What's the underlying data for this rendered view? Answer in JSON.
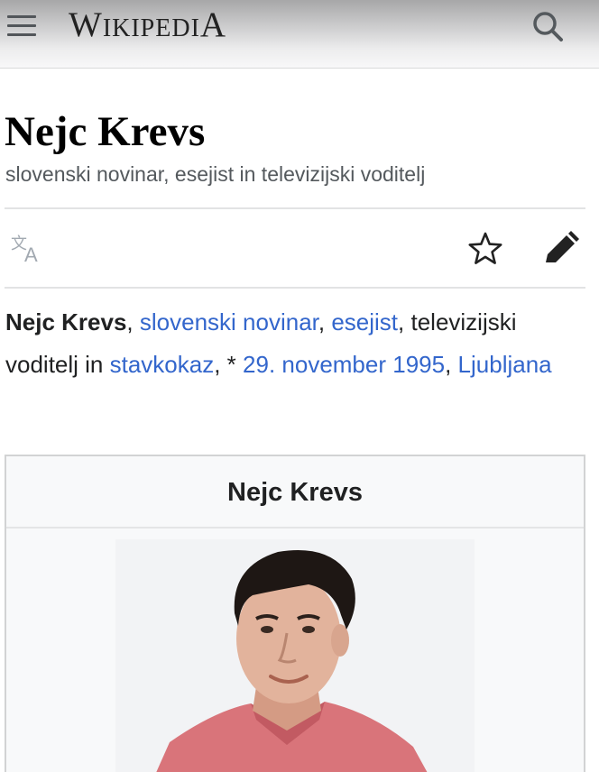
{
  "header": {
    "wordmark": "Wikipedia",
    "menu_icon": "hamburger-menu-icon",
    "search_icon": "search-icon"
  },
  "article": {
    "title": "Nejc Krevs",
    "subtitle": "slovenski novinar, esejist in televizijski voditelj"
  },
  "actions": {
    "language_icon": "language-icon",
    "watch_icon": "star-icon",
    "edit_icon": "pencil-icon"
  },
  "lead": {
    "name": "Nejc Krevs",
    "sep1": ", ",
    "link_journalist": "slovenski novinar",
    "sep2": ", ",
    "link_essayist": "esejist",
    "text_middle": ", televizijski voditelj in ",
    "link_highlighted": "stavkokaz",
    "text_birth": ", * ",
    "link_date": "29. november 1995",
    "sep3": ", ",
    "link_place": "Ljubljana"
  },
  "infobox": {
    "title": "Nejc Krevs"
  },
  "colors": {
    "link": "#3366cc",
    "highlight": "#fa7878",
    "text": "#202122"
  }
}
